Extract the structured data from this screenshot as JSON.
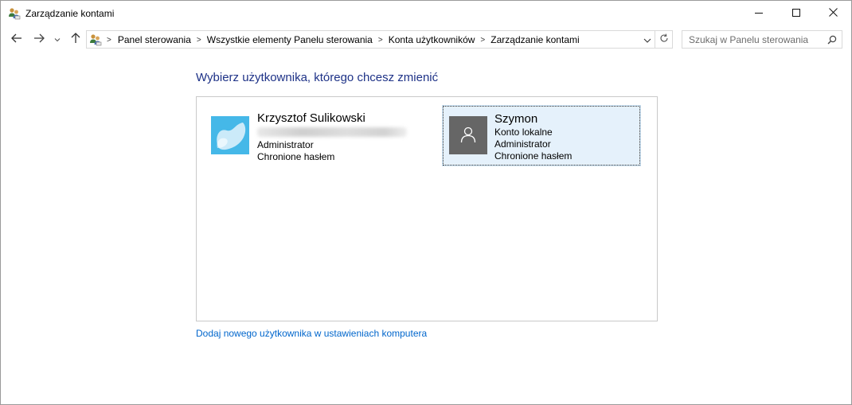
{
  "window": {
    "title": "Zarządzanie kontami",
    "icons": {
      "app": "users-control-panel-icon",
      "minimize": "minimize-icon",
      "maximize": "maximize-icon",
      "close": "close-icon"
    }
  },
  "nav": {
    "icons": {
      "back": "arrow-left-icon",
      "forward": "arrow-right-icon",
      "recent": "chevron-down-icon",
      "up": "arrow-up-icon",
      "refresh": "refresh-icon",
      "dropdown": "chevron-down-icon"
    },
    "breadcrumbs": [
      "Panel sterowania",
      "Wszystkie elementy Panelu sterowania",
      "Konta użytkowników",
      "Zarządzanie kontami"
    ],
    "search": {
      "placeholder": "Szukaj w Panelu sterowania",
      "icon": "search-icon"
    }
  },
  "main": {
    "heading": "Wybierz użytkownika, którego chcesz zmienić",
    "users": [
      {
        "name": "Krzysztof Sulikowski",
        "details": [
          "Administrator",
          "Chronione hasłem"
        ],
        "avatar": "microsoft-account-avatar",
        "selected": false
      },
      {
        "name": "Szymon",
        "details": [
          "Konto lokalne",
          "Administrator",
          "Chronione hasłem"
        ],
        "avatar": "default-user-avatar",
        "selected": true
      }
    ],
    "add_user_link": "Dodaj nowego użytkownika w ustawieniach komputera"
  },
  "colors": {
    "heading": "#1e3287",
    "link": "#0066cc",
    "selected_bg": "#e5f1fb",
    "avatar_blue": "#45b8e8",
    "avatar_gray": "#666666"
  }
}
